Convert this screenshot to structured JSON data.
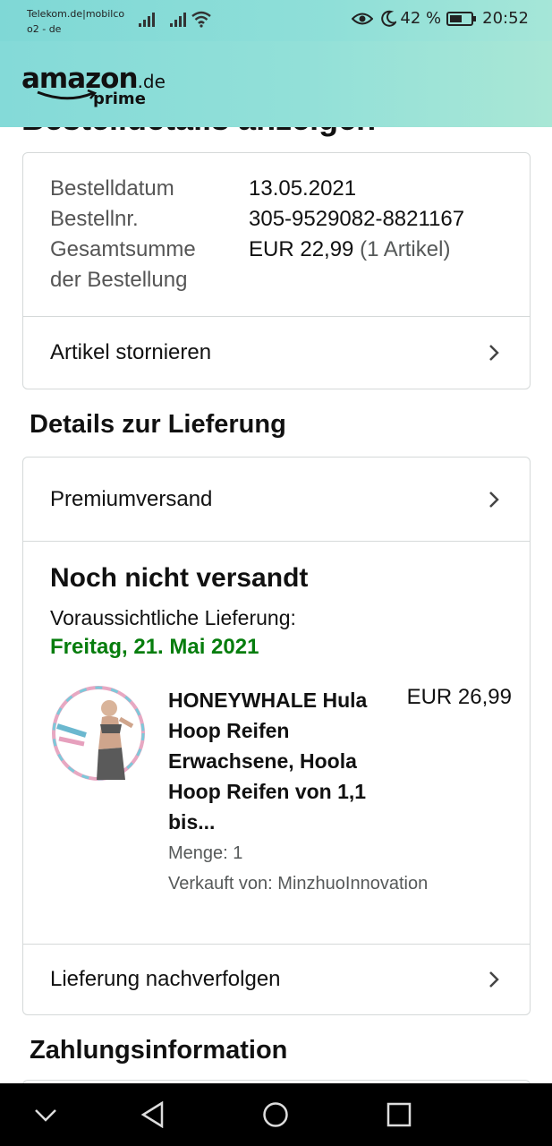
{
  "status_bar": {
    "carrier_line1": "Telekom.de|mobilco",
    "carrier_line2": "o2 - de",
    "battery": "42 %",
    "time": "20:52"
  },
  "header": {
    "logo_main": "amazon",
    "logo_suffix": ".de",
    "logo_prime": "prime"
  },
  "page_title": "Bestelldetails anzeigen",
  "order_summary": {
    "date_label": "Bestelldatum",
    "date_value": "13.05.2021",
    "number_label": "Bestellnr.",
    "number_value": "305-9529082-8821167",
    "total_label_line1": "Gesamtsumme",
    "total_label_line2": "der Bestellung",
    "total_value": "EUR 22,99",
    "total_count": "(1 Artikel)",
    "cancel_link": "Artikel stornieren"
  },
  "delivery": {
    "section_title": "Details zur Lieferung",
    "shipping_method": "Premiumversand",
    "status": "Noch nicht versandt",
    "estimate_label": "Voraussichtliche Lieferung:",
    "estimate_date": "Freitag, 21. Mai 2021",
    "item": {
      "title": "HONEYWHALE Hula Hoop Reifen Erwachsene, Hoola Hoop Reifen von 1,1 bis...",
      "price": "EUR 26,99",
      "quantity": "Menge: 1",
      "seller": "Verkauft von: MinzhuoInnovation"
    },
    "track_link": "Lieferung nachverfolgen"
  },
  "payment": {
    "section_title": "Zahlungsinformation"
  },
  "colors": {
    "accent_green": "#067d0d",
    "header_teal": "#8fdfd8",
    "border": "#d5d9d9"
  },
  "icons": [
    "signal-icon",
    "wifi-icon",
    "eye-icon",
    "moon-icon",
    "battery-icon",
    "chevron-right-icon",
    "back-nav-icon",
    "home-nav-icon",
    "recents-nav-icon",
    "collapse-nav-icon"
  ]
}
